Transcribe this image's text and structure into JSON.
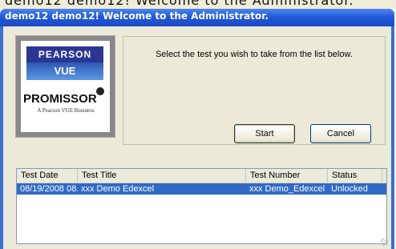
{
  "behind_title": "demo12 demo12! Welcome to the Administrator.",
  "window": {
    "title": "demo12 demo12! Welcome to the Administrator."
  },
  "logo": {
    "pearson": "PEARSON",
    "vue": "VUE",
    "promissor": "PROMISSOR",
    "tagline": "A Pearson VUE Business"
  },
  "main": {
    "prompt": "Select the test you wish to take from the list below.",
    "start_label": "Start",
    "cancel_label": "Cancel"
  },
  "table": {
    "columns": [
      "Test Date",
      "Test Title",
      "Test Number",
      "Status"
    ],
    "rows": [
      {
        "date": "08/19/2008 08...",
        "title": "xxx Demo Edexcel",
        "number": "xxx Demo_Edexcel",
        "status": "Unlocked",
        "selected": true
      }
    ]
  },
  "colors": {
    "titlebar": "#245edb",
    "face": "#ece9d8",
    "selection": "#316ac5",
    "pearson_blue": "#2b3592"
  }
}
